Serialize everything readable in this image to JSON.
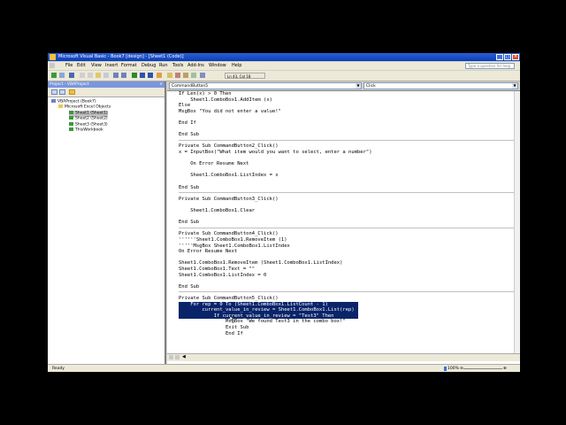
{
  "window": {
    "title": "Microsoft Visual Basic - Book7 [design] - [Sheet1 (Code)]"
  },
  "menu": {
    "items": [
      "File",
      "Edit",
      "View",
      "Insert",
      "Format",
      "Debug",
      "Run",
      "Tools",
      "Add-Ins",
      "Window",
      "Help"
    ],
    "help_placeholder": "Type a question for help"
  },
  "toolbar": {
    "position": "Ln 43, Col 18"
  },
  "project": {
    "title": "Project - VBAProject",
    "tree": [
      {
        "label": "VBAProject (Book7)",
        "level": 0
      },
      {
        "label": "Microsoft Excel Objects",
        "level": 1
      },
      {
        "label": "Sheet1 (Sheet1)",
        "level": 2,
        "selected": true
      },
      {
        "label": "Sheet2 (Sheet2)",
        "level": 2
      },
      {
        "label": "Sheet3 (Sheet3)",
        "level": 2
      },
      {
        "label": "ThisWorkbook",
        "level": 2
      }
    ]
  },
  "code_window": {
    "object_combo": "CommandButton5",
    "procedure_combo": "Click",
    "lines": [
      "If Len(x) > 0 Then",
      "    Sheet1.ComboBox1.AddItem (x)",
      "Else",
      "MsgBox \"You did not enter a value!\"",
      "",
      "End If",
      "",
      "End Sub",
      "",
      "Private Sub CommandButton2_Click()",
      "x = InputBox(\"What item would you want to select, enter a number\")",
      "",
      "    On Error Resume Next",
      "",
      "    Sheet1.ComboBox1.ListIndex = x",
      "",
      "End Sub",
      "",
      "Private Sub CommandButton3_Click()",
      "",
      "    Sheet1.ComboBox1.Clear",
      "",
      "End Sub",
      "",
      "Private Sub CommandButton4_Click()",
      "''''''Sheet1.ComboBox1.RemoveItem (1)",
      "'''''MsgBox Sheet1.ComboBox1.ListIndex",
      "On Error Resume Next",
      "",
      "Sheet1.ComboBox1.RemoveItem (Sheet1.ComboBox1.ListIndex)",
      "Sheet1.ComboBox1.Text = \"\"",
      "Sheet1.ComboBox1.ListIndex = 0",
      "",
      "End Sub",
      "",
      "Private Sub CommandButton5_Click()",
      "    For rep = 0 To (Sheet1.ComboBox1.ListCount - 1)",
      "        current_value_in_review = Sheet1.ComboBox1.List(rep)",
      "            If current_value_in_review = \"Test3\" Then",
      "                MsgBox \"We found Test3 in the combo box!\"",
      "                Exit Sub",
      "                End If"
    ]
  },
  "status": {
    "text": "Ready",
    "zoom": "100%"
  }
}
